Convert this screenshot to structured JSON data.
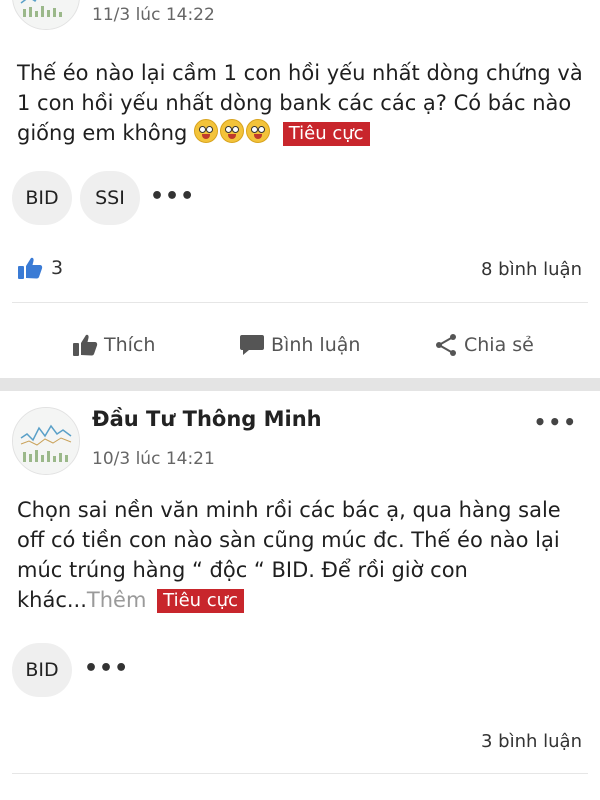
{
  "post1": {
    "time": "11/3 lúc 14:22",
    "content": "Thế éo nào lại cầm 1 con hồi yếu nhất dòng chứng và 1 con hồi yếu nhất dòng bank các các ạ? Có bác nào giống em không",
    "sentiment": "Tiêu cực",
    "tickers": [
      "BID",
      "SSI"
    ],
    "more_tickers": "•••",
    "likes": "3",
    "comments": "8 bình luận",
    "actions": {
      "like": "Thích",
      "comment": "Bình luận",
      "share": "Chia sẻ"
    }
  },
  "post2": {
    "author": "Đầu Tư Thông Minh",
    "time": "10/3 lúc 14:21",
    "more": "•••",
    "content": "Chọn sai nền văn minh rồi các bác ạ, qua hàng sale off có tiền con nào sàn cũng múc đc. Thế éo nào lại múc trúng hàng “ độc “ BID. Để rồi giờ con khác...",
    "more_link": "Thêm",
    "sentiment": "Tiêu cực",
    "tickers": [
      "BID"
    ],
    "more_tickers": "•••",
    "comments": "3 bình luận"
  },
  "colors": {
    "badge": "#c8262c",
    "like_icon": "#3a7bd5",
    "separator": "#e4e4e4"
  }
}
